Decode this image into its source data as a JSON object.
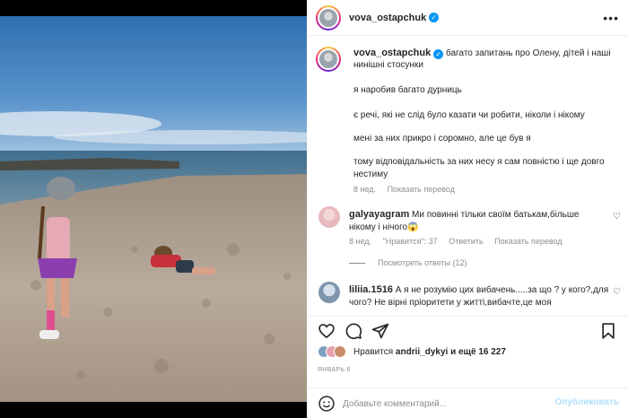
{
  "post": {
    "username": "vova_ostapchuk",
    "verified_icon": "verified-badge-icon",
    "more_icon": "more-options-icon"
  },
  "caption": {
    "username": "vova_ostapchuk",
    "line1": "багато запитань про Олену, дітей і наші",
    "line2": "нинішні стосунки",
    "p1": "я наробив багато дурниць",
    "p2": "є речі, які не слід було казати чи робити, ніколи і нікому",
    "p3": "мені за них прикро і соромно, але це був я",
    "p4a": "тому відповідальність за них несу я сам повністю і ще довго",
    "p4b": "нестиму",
    "age": "8 нед.",
    "translate": "Показать перевод"
  },
  "comments": [
    {
      "username": "galyayagram",
      "text1": "Ми повинні тільки своїм батькам,більше",
      "text2": "нікому і нічого😱",
      "age": "8 нед.",
      "likes": "\"Нравится\": 37",
      "reply": "Ответить",
      "translate": "Показать перевод",
      "view_replies": "Посмотреть ответы (12)"
    },
    {
      "username": "liliia.1516",
      "text1": "А я не розумію цих вибачень.....за що ? у кого?,для",
      "text2": "чого? Не вірні пріоритети у житті,вибачте,це моя"
    }
  ],
  "actions": {
    "like_icon": "heart-icon",
    "comment_icon": "comment-icon",
    "share_icon": "share-icon",
    "save_icon": "bookmark-icon",
    "likes_prefix": "Нравится",
    "likes_user": "andrii_dykyi",
    "likes_suffix": "и ещё 16 227",
    "date": "ЯНВАРЬ 6"
  },
  "composer": {
    "placeholder": "Добавьте комментарий...",
    "post_label": "Опубликовать",
    "emoji_icon": "emoji-icon"
  },
  "colors": {
    "accent": "#0095f6",
    "post_disabled": "#b2dffc",
    "muted": "#8e8e8e"
  }
}
